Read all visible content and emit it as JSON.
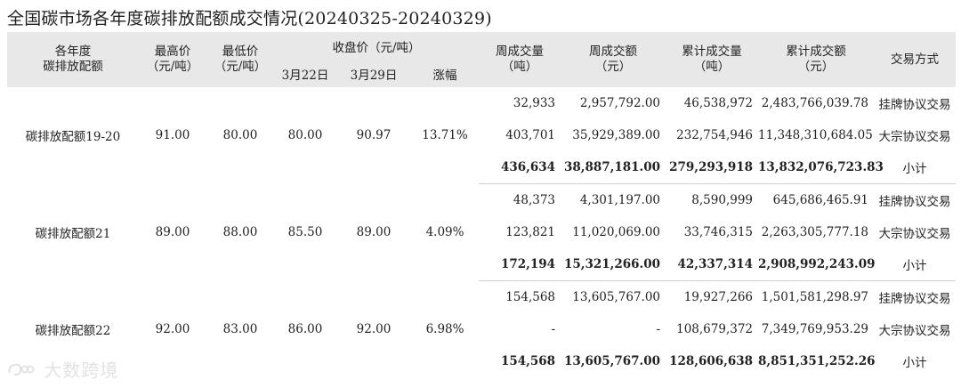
{
  "title": "全国碳市场各年度碳排放配额成交情况(20240325-20240329)",
  "headers": {
    "product": "各年度\n碳排放配额",
    "high": "最高价\n（元/吨）",
    "low": "最低价\n（元/吨）",
    "close": "收盘价（元/吨）",
    "close_d1": "3月22日",
    "close_d2": "3月29日",
    "change": "涨幅",
    "week_vol": "周成交量\n（吨）",
    "week_amt": "周成交额\n（元）",
    "cum_vol": "累计成交量\n（吨）",
    "cum_amt": "累计成交额\n（元）",
    "method": "交易方式"
  },
  "groups": [
    {
      "product": "碳排放配额19-20",
      "high": "91.00",
      "low": "80.00",
      "close_d1": "80.00",
      "close_d2": "90.97",
      "change": "13.71%",
      "rows": [
        {
          "week_vol": "32,933",
          "week_amt": "2,957,792.00",
          "cum_vol": "46,538,972",
          "cum_amt": "2,483,766,039.78",
          "method": "挂牌协议交易"
        },
        {
          "week_vol": "403,701",
          "week_amt": "35,929,389.00",
          "cum_vol": "232,754,946",
          "cum_amt": "11,348,310,684.05",
          "method": "大宗协议交易"
        },
        {
          "week_vol": "436,634",
          "week_amt": "38,887,181.00",
          "cum_vol": "279,293,918",
          "cum_amt": "13,832,076,723.83",
          "method": "小计"
        }
      ]
    },
    {
      "product": "碳排放配额21",
      "high": "89.00",
      "low": "88.00",
      "close_d1": "85.50",
      "close_d2": "89.00",
      "change": "4.09%",
      "rows": [
        {
          "week_vol": "48,373",
          "week_amt": "4,301,197.00",
          "cum_vol": "8,590,999",
          "cum_amt": "645,686,465.91",
          "method": "挂牌协议交易"
        },
        {
          "week_vol": "123,821",
          "week_amt": "11,020,069.00",
          "cum_vol": "33,746,315",
          "cum_amt": "2,263,305,777.18",
          "method": "大宗协议交易"
        },
        {
          "week_vol": "172,194",
          "week_amt": "15,321,266.00",
          "cum_vol": "42,337,314",
          "cum_amt": "2,908,992,243.09",
          "method": "小计"
        }
      ]
    },
    {
      "product": "碳排放配额22",
      "high": "92.00",
      "low": "83.00",
      "close_d1": "86.00",
      "close_d2": "92.00",
      "change": "6.98%",
      "rows": [
        {
          "week_vol": "154,568",
          "week_amt": "13,605,767.00",
          "cum_vol": "19,927,266",
          "cum_amt": "1,501,581,298.97",
          "method": "挂牌协议交易"
        },
        {
          "week_vol": "-",
          "week_amt": "-",
          "cum_vol": "108,679,372",
          "cum_amt": "7,349,769,953.29",
          "method": "大宗协议交易"
        },
        {
          "week_vol": "154,568",
          "week_amt": "13,605,767.00",
          "cum_vol": "128,606,638",
          "cum_amt": "8,851,351,252.26",
          "method": "小计"
        }
      ]
    }
  ],
  "watermark": "大数跨境"
}
